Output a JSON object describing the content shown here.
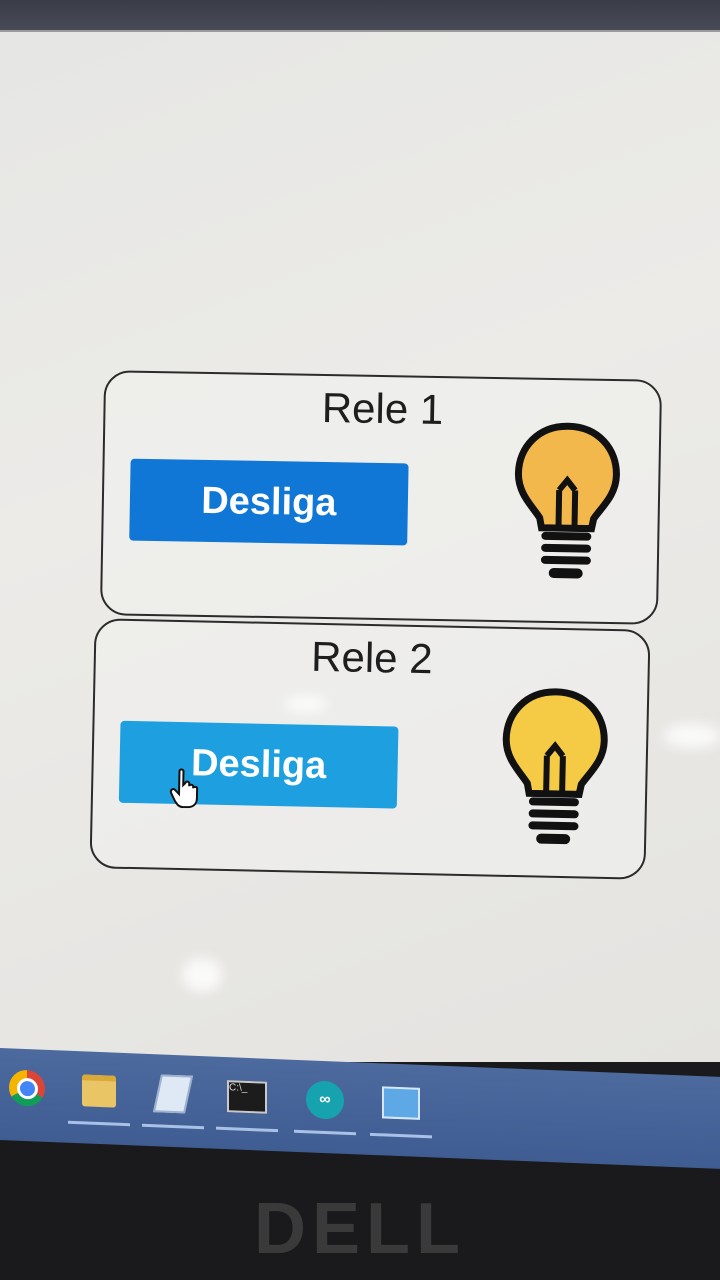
{
  "relays": [
    {
      "title": "Rele 1",
      "button_label": "Desliga",
      "bulb_icon": "lightbulb-icon",
      "bulb_color": "#f2b84c",
      "button_color": "#1177d6"
    },
    {
      "title": "Rele 2",
      "button_label": "Desliga",
      "bulb_icon": "lightbulb-icon",
      "bulb_color": "#f5cb45",
      "button_color": "#1ea0e0"
    }
  ],
  "taskbar": {
    "apps": [
      "chrome-icon",
      "file-explorer-icon",
      "explorer-window-icon",
      "terminal-icon",
      "arduino-icon",
      "remote-desktop-icon"
    ]
  },
  "monitor": {
    "brand": "DELL"
  }
}
